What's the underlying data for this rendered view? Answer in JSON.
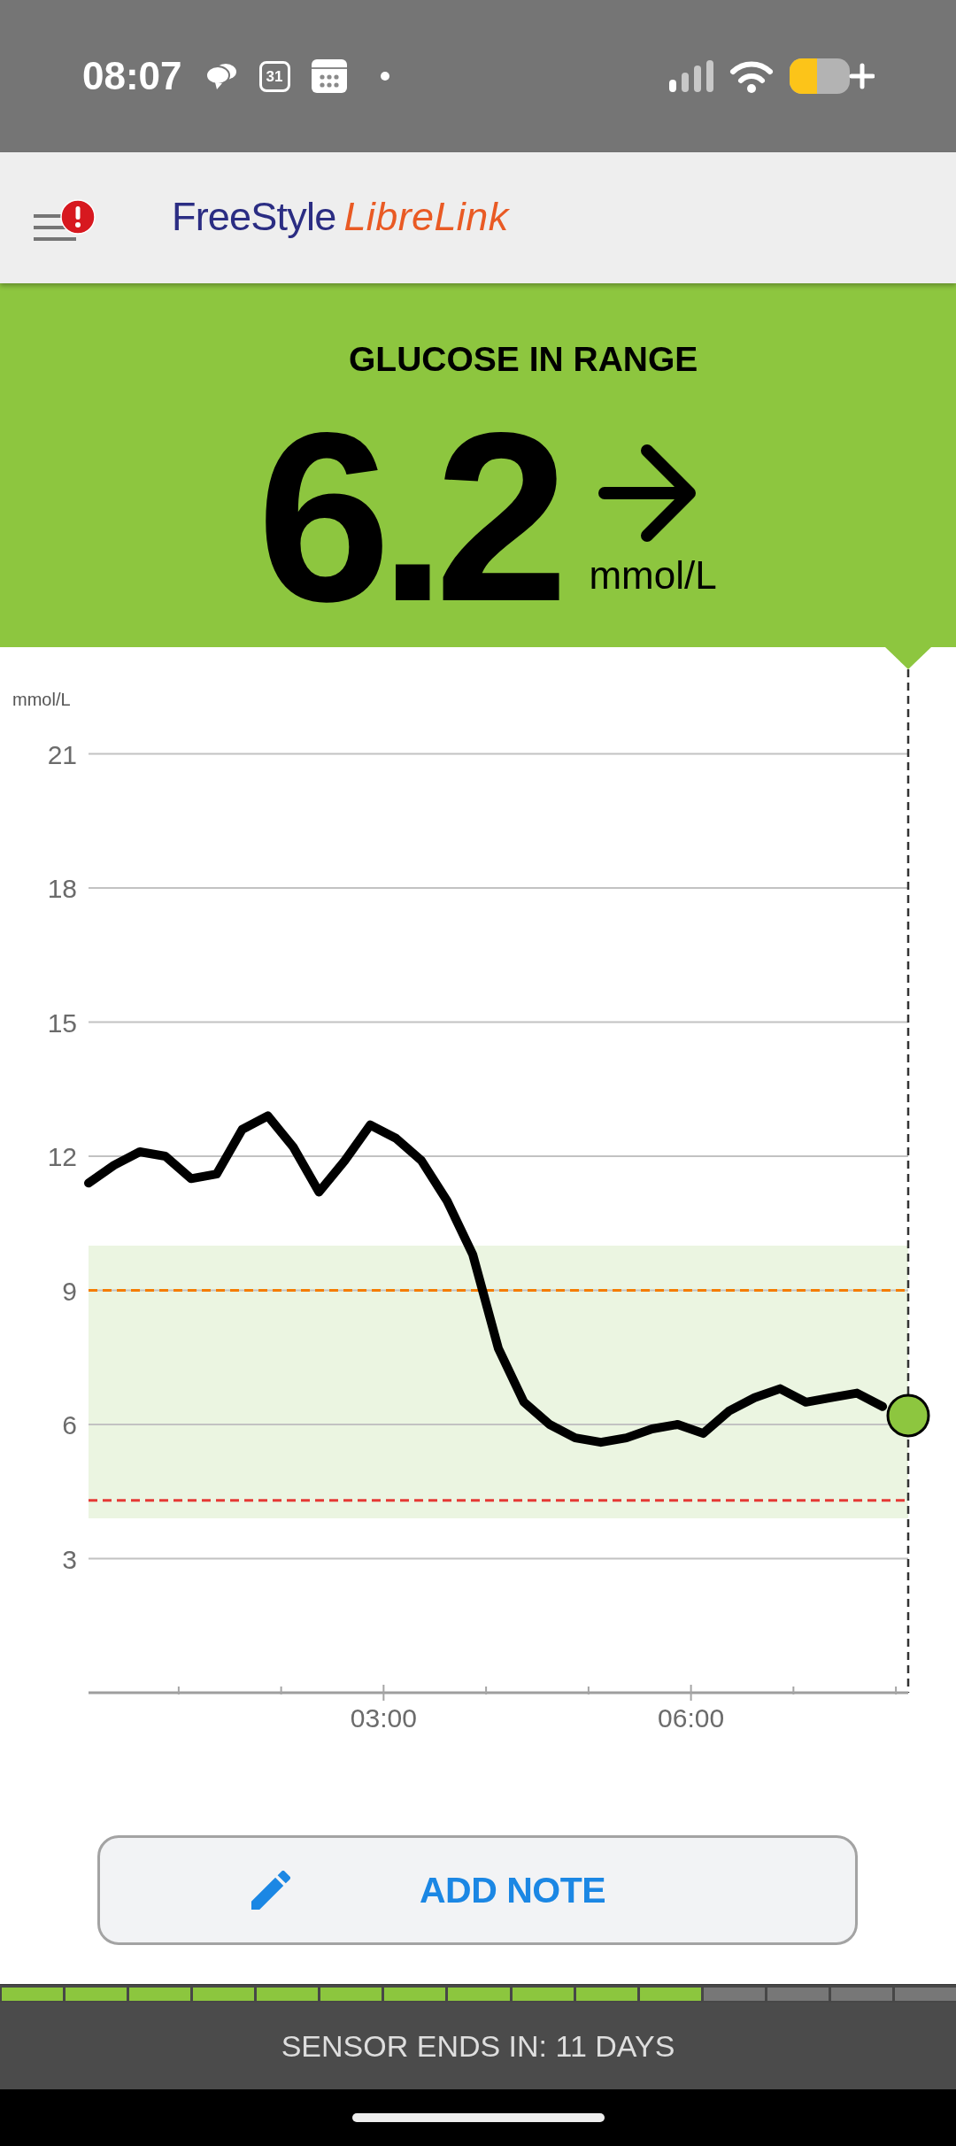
{
  "status_bar": {
    "time": "08:07",
    "calendar_date": "31"
  },
  "header": {
    "menu": {
      "alert": true
    },
    "logo": {
      "brand": "FreeStyle",
      "product": "LibreLink"
    }
  },
  "banner": {
    "status": "GLUCOSE IN RANGE",
    "in_range": true,
    "reading": "6.2",
    "unit": "mmol/L",
    "trend_arrow": {
      "kind": "flat"
    }
  },
  "chart": {
    "chart_data": {
      "type": "line",
      "ylabel": "mmol/L",
      "x": [
        0.12,
        0.37,
        0.62,
        0.87,
        1.12,
        1.37,
        1.62,
        1.87,
        2.12,
        2.37,
        2.62,
        2.87,
        3.12,
        3.37,
        3.62,
        3.87,
        4.12,
        4.37,
        4.62,
        4.87,
        5.12,
        5.37,
        5.62,
        5.87,
        6.12,
        6.37,
        6.62,
        6.87,
        7.12,
        7.37,
        7.62,
        7.87
      ],
      "values": [
        11.4,
        11.8,
        12.1,
        12.0,
        11.5,
        11.6,
        12.6,
        12.9,
        12.2,
        11.2,
        11.9,
        12.7,
        12.4,
        11.9,
        11.0,
        9.8,
        7.7,
        6.5,
        6.0,
        5.7,
        5.6,
        5.7,
        5.9,
        6.0,
        5.8,
        6.3,
        6.6,
        6.8,
        6.5,
        6.6,
        6.7,
        6.4
      ],
      "xlim": [
        0.12,
        8.12
      ],
      "ylim": [
        0,
        21
      ],
      "xticks": [
        {
          "value": 3,
          "label": "03:00"
        },
        {
          "value": 6,
          "label": "06:00"
        }
      ],
      "yticks": [
        3,
        6,
        9,
        12,
        15,
        18,
        21
      ],
      "grid": true,
      "bands": [
        {
          "axis": "y",
          "from": 3.9,
          "to": 10,
          "color": "#ebf5e1"
        }
      ],
      "ref_lines": [
        {
          "axis": "y",
          "value": 9,
          "color": "#f57c00"
        },
        {
          "axis": "y",
          "value": 4.3,
          "color": "#e53935"
        },
        {
          "axis": "x",
          "value": 8.12,
          "color": "#333333"
        }
      ]
    }
  },
  "note_button": {
    "label": "ADD NOTE"
  },
  "sensor": {
    "segments": [
      {
        "filled": true
      },
      {
        "filled": true
      },
      {
        "filled": true
      },
      {
        "filled": true
      },
      {
        "filled": true
      },
      {
        "filled": true
      },
      {
        "filled": true
      },
      {
        "filled": true
      },
      {
        "filled": true
      },
      {
        "filled": true
      },
      {
        "filled": true
      },
      {
        "filled": false
      },
      {
        "filled": false
      },
      {
        "filled": false
      },
      {
        "filled": false
      }
    ],
    "text": "SENSOR ENDS IN: 11 DAYS"
  }
}
